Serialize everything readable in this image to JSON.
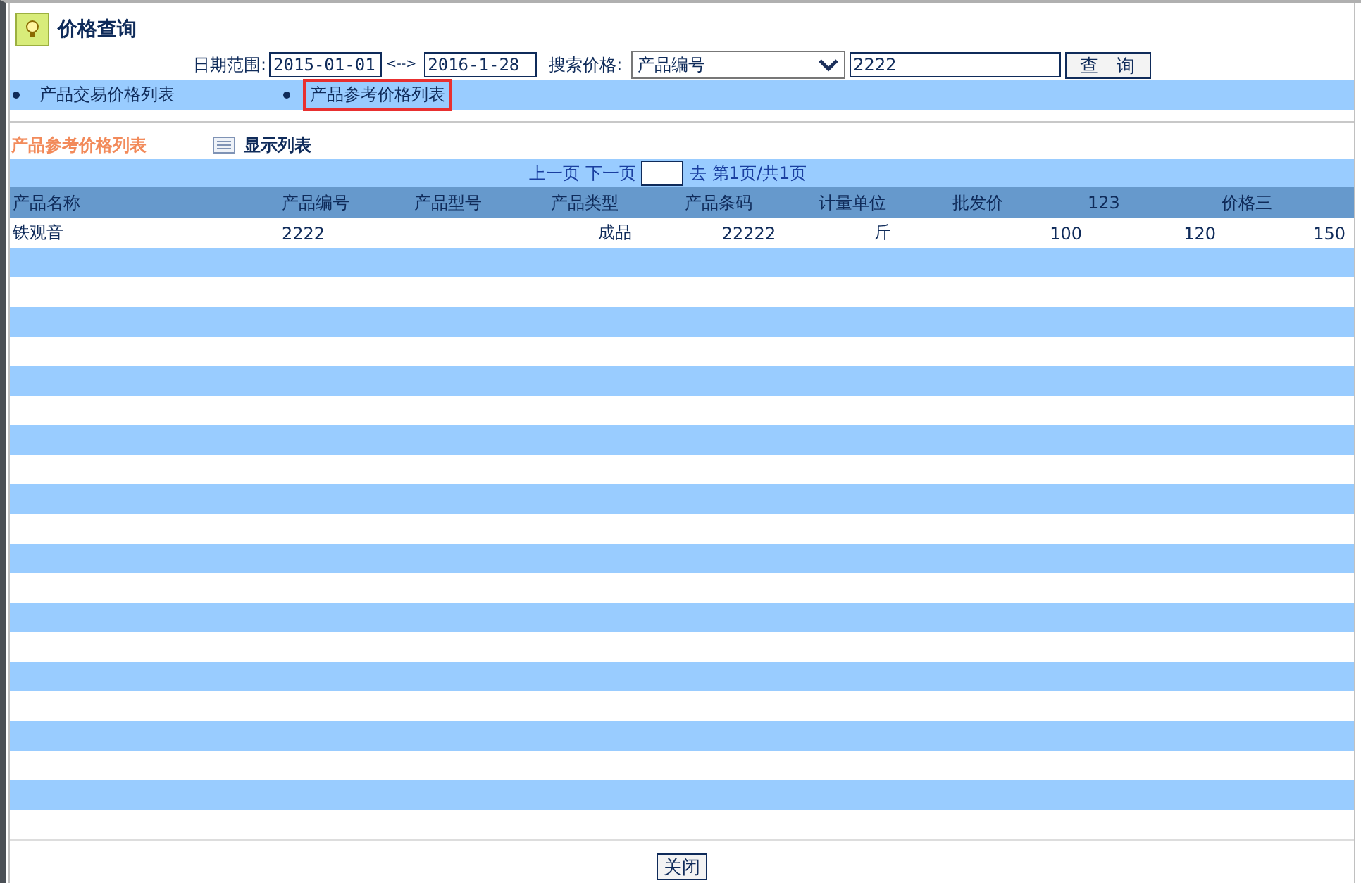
{
  "title": "价格查询",
  "filters": {
    "date_label": "日期范围:",
    "date_from": "2015-01-01",
    "range_sep": "<-->",
    "date_to": "2016-1-28",
    "search_label": "搜索价格:",
    "search_field": "产品编号",
    "search_value": "2222",
    "query_button": "查　询"
  },
  "tabs": [
    {
      "label": "产品交易价格列表",
      "selected": false
    },
    {
      "label": "产品参考价格列表",
      "selected": true
    }
  ],
  "section": {
    "title": "产品参考价格列表",
    "view_label": "显示列表"
  },
  "pager": {
    "prev": "上一页",
    "next": "下一页",
    "go": "去",
    "info": "第1页/共1页"
  },
  "table": {
    "columns": [
      "产品名称",
      "产品编号",
      "产品型号",
      "产品类型",
      "产品条码",
      "计量单位",
      "批发价",
      "123",
      "价格三"
    ],
    "rows": [
      [
        "铁观音",
        "2222",
        "",
        "成品",
        "22222",
        "斤",
        "100",
        "120",
        "150"
      ]
    ]
  },
  "close_button": "关闭"
}
